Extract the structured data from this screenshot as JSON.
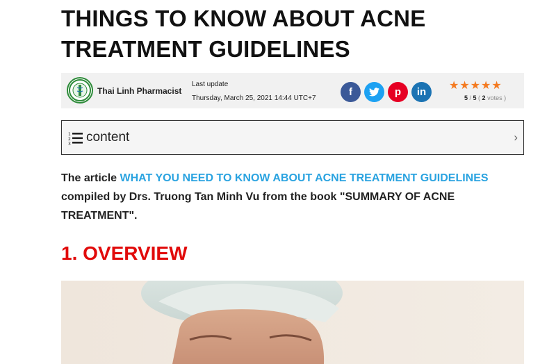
{
  "article": {
    "title_line1": "THINGS TO KNOW ABOUT ACNE",
    "title_line2": "TREATMENT GUIDELINES"
  },
  "meta": {
    "author": "Thai Linh Pharmacist",
    "last_update_label": "Last update",
    "date": "Thursday, March 25, 2021 14:44 UTC+7",
    "rating": "5",
    "rating_max": "5",
    "votes": "2",
    "votes_label": "votes",
    "star_count": 5,
    "star_color": "#f47a20"
  },
  "social": {
    "facebook": "f",
    "twitter": "t",
    "pinterest": "p",
    "linkedin": "in"
  },
  "toc": {
    "label": "content",
    "icon": "list-numbered-icon",
    "chevron": "›"
  },
  "intro": {
    "prefix": "The article ",
    "link": "WHAT YOU NEED TO KNOW ABOUT ACNE TREATMENT GUIDELINES",
    "suffix": " compiled by Drs. Truong Tan Minh Vu from the book \"SUMMARY OF ACNE TREATMENT\"."
  },
  "section": {
    "heading": "1. OVERVIEW"
  },
  "colors": {
    "heading_red": "#e10b0b",
    "link_blue": "#2aa3e0"
  }
}
